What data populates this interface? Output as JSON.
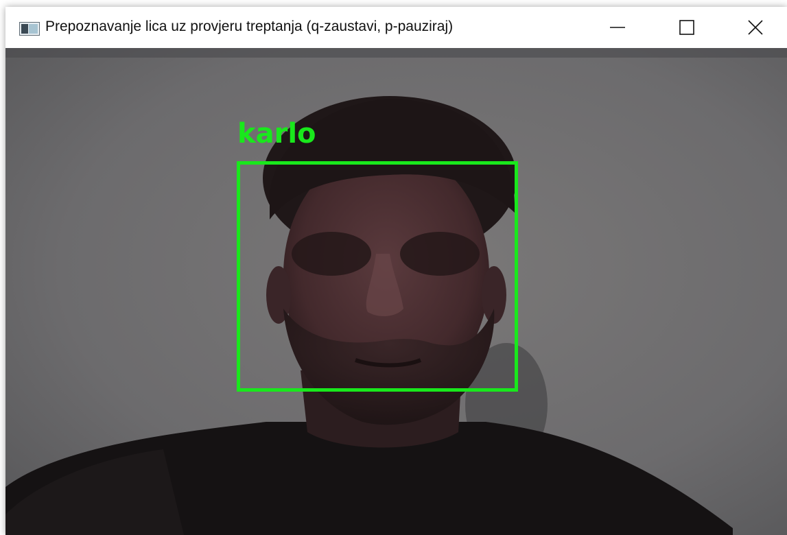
{
  "window": {
    "title": "Prepoznavanje lica uz provjeru treptanja (q-zaustavi, p-pauziraj)",
    "controls": {
      "minimize": "minimize-icon",
      "maximize": "maximize-icon",
      "close": "close-icon"
    }
  },
  "camera": {
    "detection": {
      "name": "karlo",
      "color": "#19e81c"
    }
  }
}
